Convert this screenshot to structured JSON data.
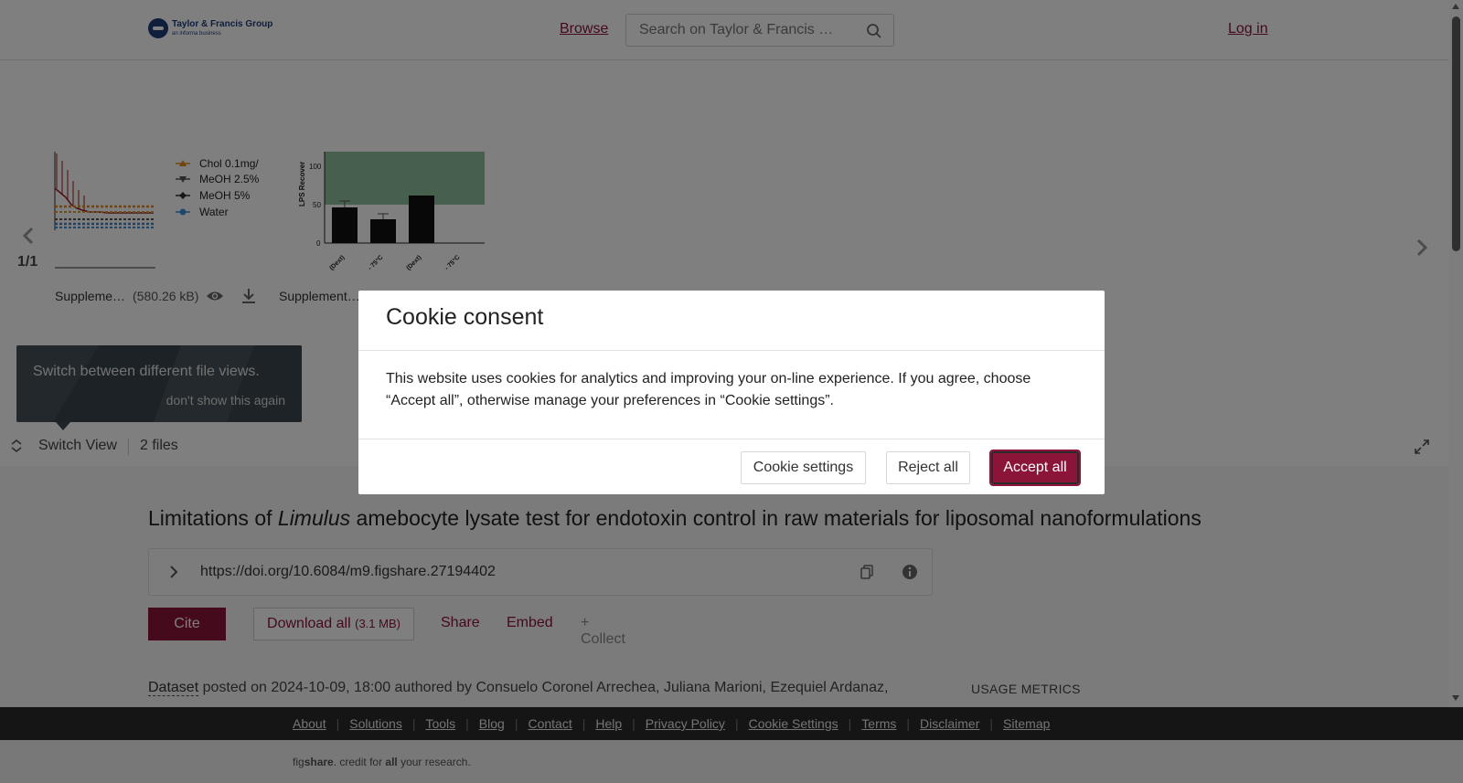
{
  "header": {
    "logo_title": "Taylor & Francis Group",
    "logo_sub": "an informa business",
    "browse": "Browse",
    "search_placeholder": "Search on Taylor & Francis …",
    "login": "Log in"
  },
  "viewer": {
    "counter": "1/1",
    "files": [
      {
        "name": "Suppleme…",
        "size": "(580.26 kB)"
      },
      {
        "name": "Supplement…"
      }
    ],
    "thumb1_legend": [
      "Chol 0.1mg/",
      "MeOH 2.5%",
      "MeOH 5%",
      "Water"
    ],
    "thumb2_ylabel": "LPS Recover",
    "thumb2_yticks": [
      "100",
      "50",
      "0"
    ],
    "thumb2_xticks": [
      "(Dext)",
      "- 75°C",
      "(Dext)",
      "- 75°C"
    ],
    "tip_text": "Switch between different file views.",
    "tip_dismiss": "don't show this again",
    "switch_view": "Switch View",
    "files_count": "2 files"
  },
  "article": {
    "title_pre": "Limitations of ",
    "title_italic": "Limulus",
    "title_post": " amebocyte lysate test for endotoxin control in raw materials for liposomal nanoformulations",
    "doi": "https://doi.org/10.6084/m9.figshare.27194402",
    "cite": "Cite",
    "download_all": "Download all",
    "download_size": "(3.1 MB)",
    "share": "Share",
    "embed": "Embed",
    "collect": "+ Collect",
    "dataset": "Dataset",
    "meta_text": " posted on 2024-10-09, 18:00 authored by Consuelo Coronel Arrechea, Juliana Marioni, Ezequiel Ardanaz,",
    "usage_metrics": "USAGE METRICS"
  },
  "footer": {
    "links": [
      "About",
      "Solutions",
      "Tools",
      "Blog",
      "Contact",
      "Help",
      "Privacy Policy",
      "Cookie Settings",
      "Terms",
      "Disclaimer",
      "Sitemap"
    ],
    "note_pre": "fig",
    "note_brand": "share",
    "note_mid": ". credit for ",
    "note_bold": "all",
    "note_post": " your research."
  },
  "cookie_modal": {
    "title": "Cookie consent",
    "body": "This website uses cookies for analytics and improving your on-line experience. If you agree, choose “Accept all”, otherwise manage your preferences in “Cookie settings”.",
    "settings": "Cookie settings",
    "reject": "Reject all",
    "accept": "Accept all"
  },
  "colors": {
    "brand": "#8a1538",
    "footer_bg": "#2b2b2b",
    "logo_blue": "#1f3d7a"
  }
}
